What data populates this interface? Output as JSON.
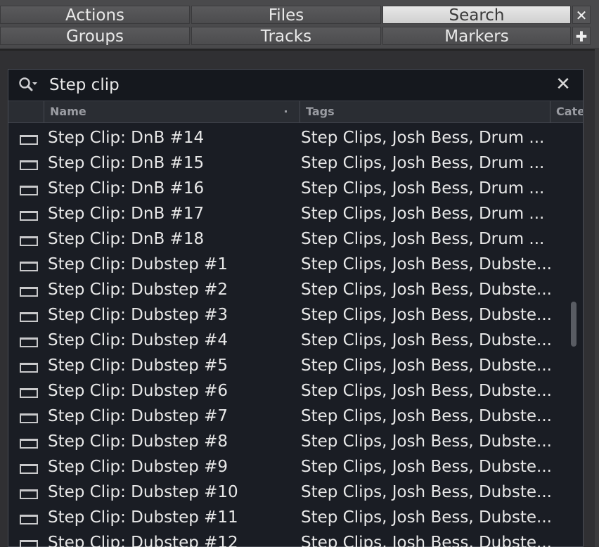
{
  "tabs_row1": [
    {
      "label": "Actions",
      "active": false
    },
    {
      "label": "Files",
      "active": false
    },
    {
      "label": "Search",
      "active": true
    }
  ],
  "tabs_row2": [
    {
      "label": "Groups",
      "active": false
    },
    {
      "label": "Tracks",
      "active": false
    },
    {
      "label": "Markers",
      "active": false
    }
  ],
  "side_buttons": {
    "close": "✕",
    "add": "✚"
  },
  "search": {
    "value": "Step clip",
    "clear": "✕"
  },
  "columns": {
    "name": "Name",
    "tags": "Tags",
    "category": "Cate"
  },
  "results": [
    {
      "name": "Step Clip: DnB #14",
      "tags": "Step Clips, Josh Bess, Drum ..."
    },
    {
      "name": "Step Clip: DnB #15",
      "tags": "Step Clips, Josh Bess, Drum ..."
    },
    {
      "name": "Step Clip: DnB #16",
      "tags": "Step Clips, Josh Bess, Drum ..."
    },
    {
      "name": "Step Clip: DnB #17",
      "tags": "Step Clips, Josh Bess, Drum ..."
    },
    {
      "name": "Step Clip: DnB #18",
      "tags": "Step Clips, Josh Bess, Drum ..."
    },
    {
      "name": "Step Clip: Dubstep #1",
      "tags": "Step Clips, Josh Bess, Dubste..."
    },
    {
      "name": "Step Clip: Dubstep #2",
      "tags": "Step Clips, Josh Bess, Dubste..."
    },
    {
      "name": "Step Clip: Dubstep #3",
      "tags": "Step Clips, Josh Bess, Dubste..."
    },
    {
      "name": "Step Clip: Dubstep #4",
      "tags": "Step Clips, Josh Bess, Dubste..."
    },
    {
      "name": "Step Clip: Dubstep #5",
      "tags": "Step Clips, Josh Bess, Dubste..."
    },
    {
      "name": "Step Clip: Dubstep #6",
      "tags": "Step Clips, Josh Bess, Dubste..."
    },
    {
      "name": "Step Clip: Dubstep #7",
      "tags": "Step Clips, Josh Bess, Dubste..."
    },
    {
      "name": "Step Clip: Dubstep #8",
      "tags": "Step Clips, Josh Bess, Dubste..."
    },
    {
      "name": "Step Clip: Dubstep #9",
      "tags": "Step Clips, Josh Bess, Dubste..."
    },
    {
      "name": "Step Clip: Dubstep #10",
      "tags": "Step Clips, Josh Bess, Dubste..."
    },
    {
      "name": "Step Clip: Dubstep #11",
      "tags": "Step Clips, Josh Bess, Dubste..."
    },
    {
      "name": "Step Clip: Dubstep #12",
      "tags": "Step Clips, Josh Bess, Dubste..."
    }
  ]
}
